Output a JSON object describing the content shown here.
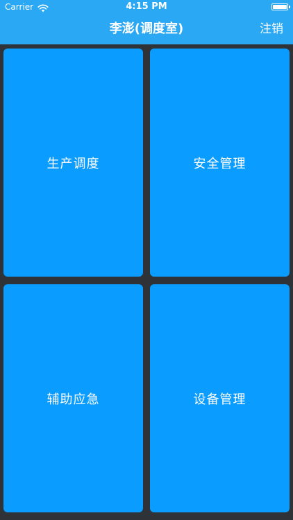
{
  "status_bar": {
    "carrier": "Carrier",
    "time": "4:15 PM",
    "battery_level": 1.0
  },
  "nav": {
    "title": "李澎(调度室)",
    "logout_label": "注销"
  },
  "tiles": [
    {
      "label": "生产调度"
    },
    {
      "label": "安全管理"
    },
    {
      "label": "辅助应急"
    },
    {
      "label": "设备管理"
    }
  ],
  "colors": {
    "nav_background": "#2aa8f4",
    "tile_background": "#0a9cff",
    "page_background": "#2f3338",
    "text": "#ffffff"
  },
  "icons": {
    "wifi": "wifi-icon",
    "battery": "battery-icon"
  }
}
